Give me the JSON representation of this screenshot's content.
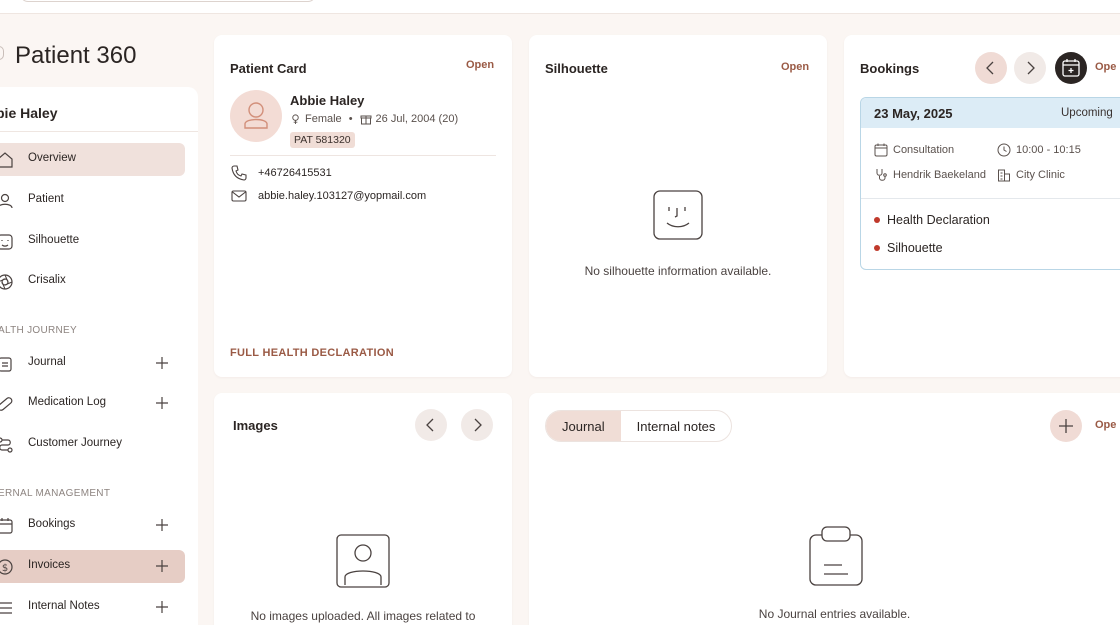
{
  "page": {
    "title": "Patient 360"
  },
  "sidebar": {
    "patient_name": "bie Haley",
    "items": [
      {
        "label": "Overview",
        "icon": "home-icon",
        "active": true
      },
      {
        "label": "Patient",
        "icon": "user-icon"
      },
      {
        "label": "Silhouette",
        "icon": "face-icon"
      },
      {
        "label": "Crisalix",
        "icon": "aperture-icon"
      }
    ],
    "section_health": "ALTH JOURNEY",
    "health_items": [
      {
        "label": "Journal",
        "icon": "clipboard-icon",
        "has_add": true
      },
      {
        "label": "Medication Log",
        "icon": "pill-icon",
        "has_add": true
      },
      {
        "label": "Customer Journey",
        "icon": "route-icon",
        "has_add": false
      }
    ],
    "section_internal": "ERNAL MANAGEMENT",
    "internal_items": [
      {
        "label": "Bookings",
        "icon": "calendar-icon",
        "has_add": true
      },
      {
        "label": "Invoices",
        "icon": "dollar-icon",
        "has_add": true,
        "highlight": true
      },
      {
        "label": "Internal Notes",
        "icon": "list-icon",
        "has_add": true
      }
    ]
  },
  "patient_card": {
    "title": "Patient Card",
    "open_label": "Open",
    "name": "Abbie Haley",
    "gender": "Female",
    "separator": "•",
    "dob": "26 Jul, 2004 (20)",
    "patient_id": "PAT 581320",
    "phone": "+46726415531",
    "email": "abbie.haley.103127@yopmail.com",
    "full_declaration_label": "FULL HEALTH DECLARATION"
  },
  "silhouette_card": {
    "title": "Silhouette",
    "open_label": "Open",
    "empty_text": "No silhouette information available."
  },
  "bookings_card": {
    "title": "Bookings",
    "open_label": "Ope",
    "booking": {
      "date": "23 May, 2025",
      "status": "Upcoming",
      "type": "Consultation",
      "time": "10:00 - 10:15",
      "practitioner": "Hendrik Baekeland",
      "location": "City Clinic",
      "documents": [
        "Health Declaration",
        "Silhouette"
      ]
    }
  },
  "images_card": {
    "title": "Images",
    "empty_text": "No images uploaded. All images related to"
  },
  "journal_card": {
    "tabs": [
      {
        "label": "Journal",
        "active": true
      },
      {
        "label": "Internal notes",
        "active": false
      }
    ],
    "open_label": "Ope",
    "empty_text": "No Journal entries available."
  },
  "colors": {
    "accent": "#9a5a45",
    "active_bg": "#f0e1dc",
    "booking_head": "#dcecf6",
    "status_dot": "#c0392b"
  }
}
